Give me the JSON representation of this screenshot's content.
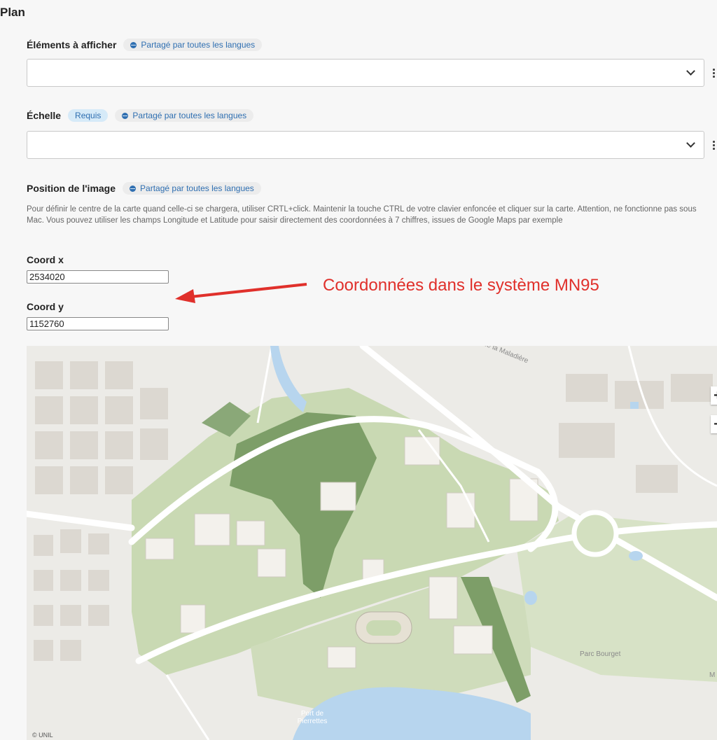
{
  "section": {
    "title": "Plan"
  },
  "fields": {
    "elements": {
      "label": "Éléments à afficher",
      "shared_badge": "Partagé par toutes les langues",
      "value": ""
    },
    "scale": {
      "label": "Échelle",
      "required_badge": "Requis",
      "shared_badge": "Partagé par toutes les langues",
      "value": ""
    },
    "position": {
      "label": "Position de l'image",
      "shared_badge": "Partagé par toutes les langues",
      "description": "Pour définir le centre de la carte quand celle-ci se chargera, utiliser CRTL+click. Maintenir la touche CTRL de votre clavier enfoncée et cliquer sur la carte. Attention, ne fonctionne pas sous Mac. Vous pouvez utiliser les champs Longitude et Latitude pour saisir directement des coordonnées à 7 chiffres, issues de Google Maps par exemple"
    }
  },
  "coords": {
    "x_label": "Coord x",
    "x_value": "2534020",
    "y_label": "Coord y",
    "y_value": "1152760"
  },
  "annotation": {
    "text": "Coordonnées dans le système MN95",
    "color": "#e0302b"
  },
  "map": {
    "zoom_in": "+",
    "zoom_out": "−",
    "labels": {
      "road": "de la Maladière",
      "park": "Parc Bourget",
      "harbor": "Port de Pierrettes",
      "edge": "M"
    },
    "copyright": "© UNIL"
  },
  "colors": {
    "badge_text": "#2f6fb1",
    "water": "#b7d5ee",
    "green": "#c9d9b3",
    "dark_green": "#7d9e68"
  }
}
